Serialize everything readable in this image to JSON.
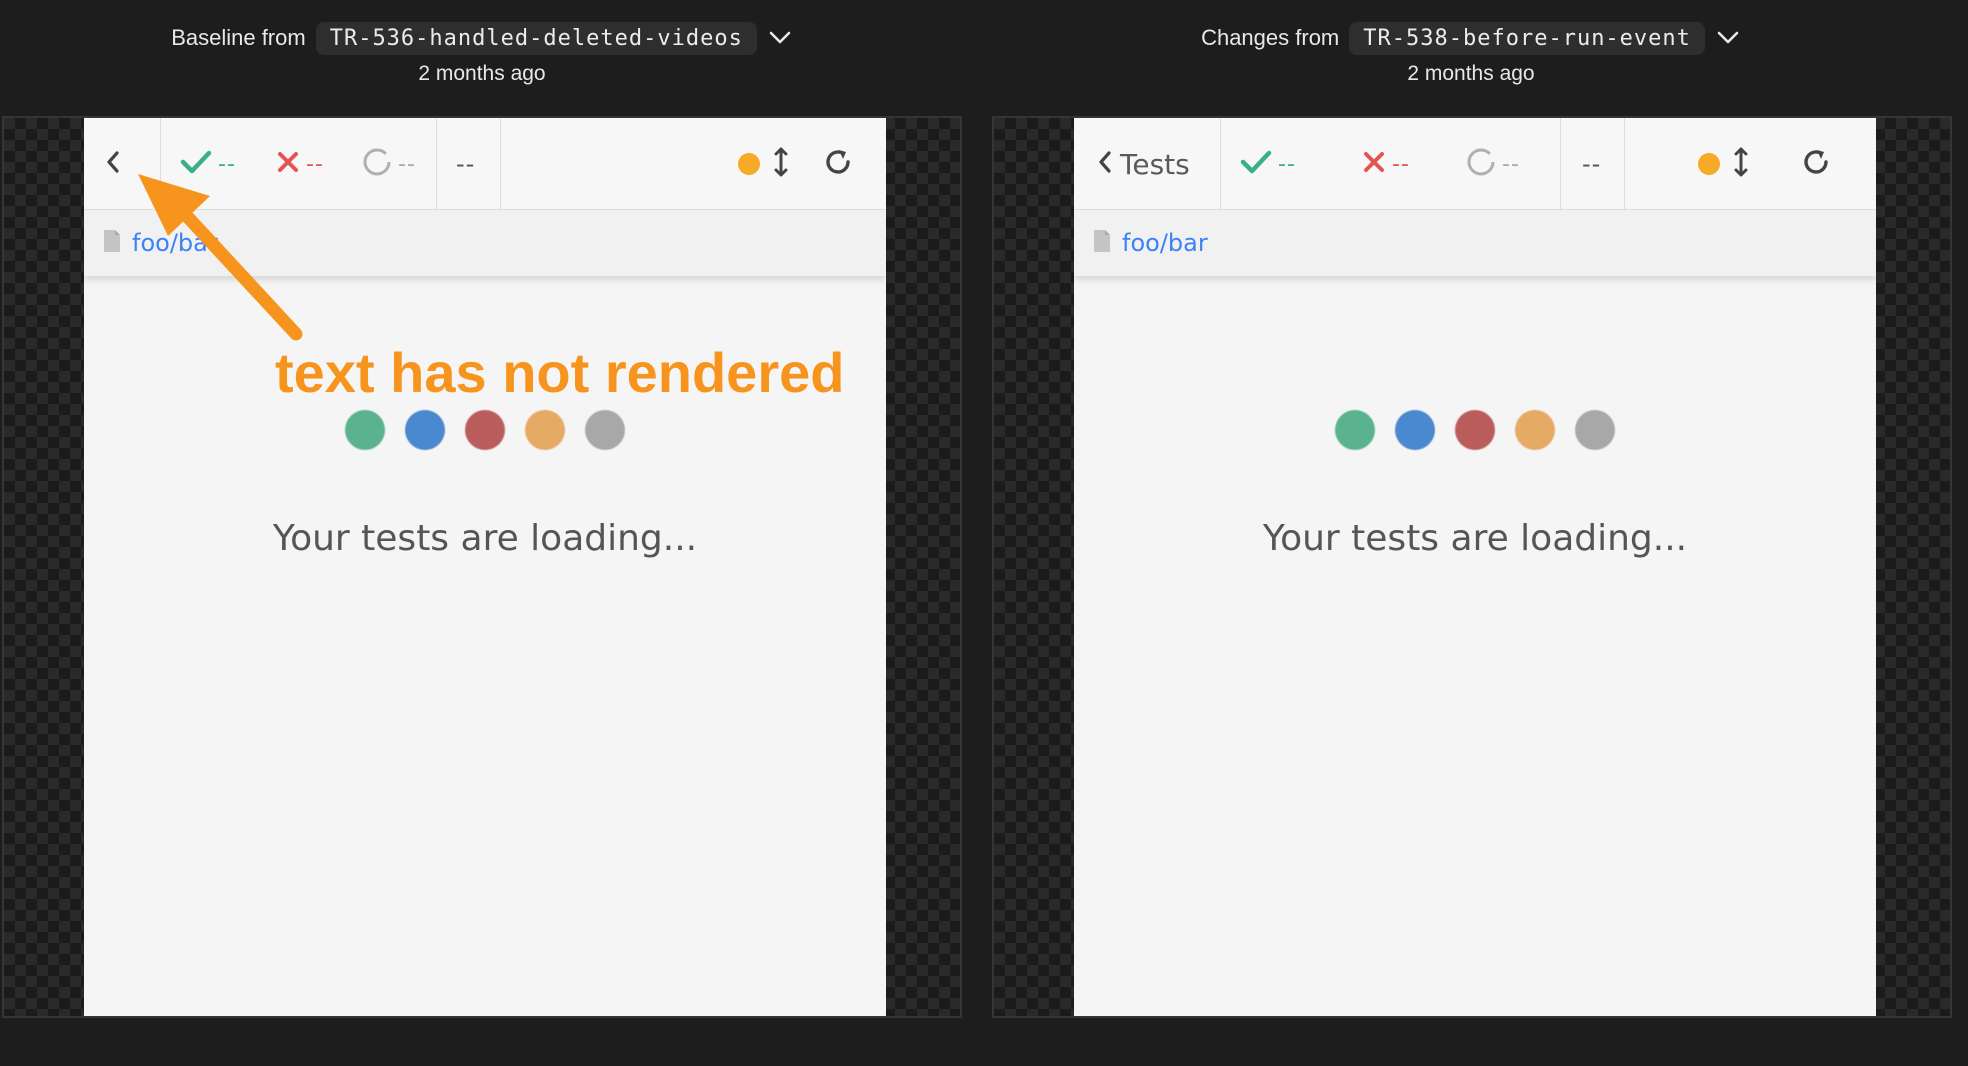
{
  "baseline": {
    "label": "Baseline from",
    "branch": "TR-536-handled-deleted-videos",
    "time": "2 months ago"
  },
  "changes": {
    "label": "Changes from",
    "branch": "TR-538-before-run-event",
    "time": "2 months ago"
  },
  "app_left": {
    "back_label": "",
    "passed": "--",
    "failed": "--",
    "pending": "--",
    "duration": "--",
    "spec_path": "foo/bar",
    "loading_text": "Your tests are loading..."
  },
  "app_right": {
    "back_label": "Tests",
    "passed": "--",
    "failed": "--",
    "pending": "--",
    "duration": "--",
    "spec_path": "foo/bar",
    "loading_text": "Your tests are loading..."
  },
  "annotation": {
    "text": "text has not rendered",
    "color": "#f7941d"
  },
  "colors": {
    "background": "#1d1d1d",
    "link": "#3b82f6",
    "pass": "#39b085",
    "fail": "#e45454",
    "status_dot": "#f7a928",
    "loading_dots": [
      "#5bb28f",
      "#4a88d0",
      "#bb5c5c",
      "#e5aa63",
      "#a8a8a8"
    ]
  }
}
